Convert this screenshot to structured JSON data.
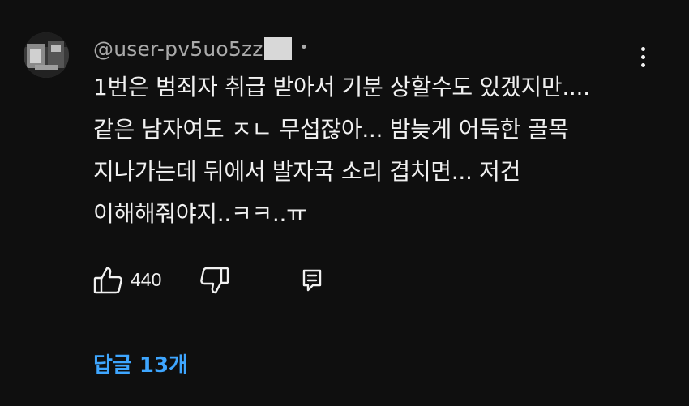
{
  "comment": {
    "author": "@user-pv5uo5zz",
    "author_separator": "•",
    "lines": [
      "1번은 범죄자 취급 받아서 기분 상할수도 있겠지만....",
      "같은 남자여도 ㅈㄴ 무섭잖아... 밤늦게 어둑한 골목",
      "지나가는데 뒤에서 발자국 소리 겹치면... 저건",
      "이해해줘야지..ㅋㅋ..ㅠ"
    ],
    "like_count": "440",
    "replies_label": "답글 13개"
  },
  "icons": {
    "avatar": "avatar-image",
    "more": "more-vertical-icon",
    "like": "thumbs-up-icon",
    "dislike": "thumbs-down-icon",
    "reply": "reply-comment-icon"
  },
  "colors": {
    "background": "#0f0f0f",
    "text": "#f1f1f1",
    "secondary_text": "#aaaaaa",
    "link": "#3ea6ff"
  }
}
